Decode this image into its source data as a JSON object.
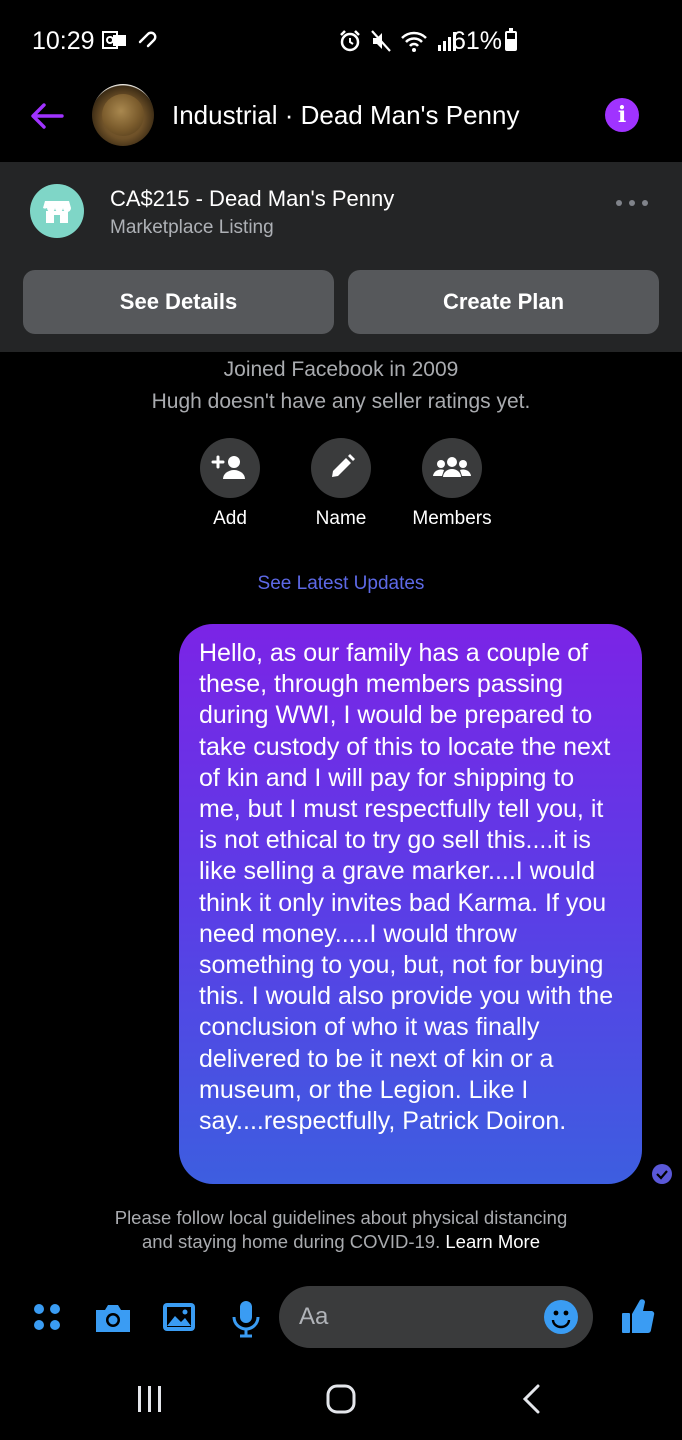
{
  "status_bar": {
    "time": "10:29",
    "battery_percent": "61%",
    "battery_level": 0.61
  },
  "header": {
    "title": "Industrial · Dead Man's Penny",
    "back_icon": "arrow-left-icon",
    "info_icon": "info-icon",
    "info_glyph": "i",
    "accent_color": "#a033ff"
  },
  "listing": {
    "title": "CA$215 - Dead Man's Penny",
    "subtitle": "Marketplace Listing",
    "see_details_label": "See Details",
    "create_plan_label": "Create Plan"
  },
  "profile": {
    "joined": "Joined Facebook in 2009",
    "ratings": "Hugh doesn't have any seller ratings yet.",
    "actions": [
      {
        "label": "Add",
        "icon": "add-person-icon"
      },
      {
        "label": "Name",
        "icon": "pencil-icon"
      },
      {
        "label": "Members",
        "icon": "group-icon"
      }
    ],
    "see_latest_updates": "See Latest Updates"
  },
  "messages": [
    {
      "sender": "me",
      "text": "Hello, as our family has a couple of these, through members passing during WWI, I would be prepared to take custody of this to locate the next of kin and I will pay for shipping to me, but I must respectfully tell you, it is not ethical to try go sell this....it is like selling a grave marker....I would think it only invites bad Karma. If you need money.....I would throw something to you, but, not for buying this. I would also provide you with the conclusion of who it was finally delivered to be it next of kin or a museum, or the Legion. Like I say....respectfully, Patrick Doiron."
    }
  ],
  "notice": {
    "line1": "Please follow local guidelines about physical distancing",
    "line2": "and staying home during COVID-19.",
    "learn_more": "Learn More"
  },
  "composer": {
    "placeholder": "Aa",
    "icons": [
      "apps-icon",
      "camera-icon",
      "gallery-icon",
      "microphone-icon",
      "emoji-icon",
      "thumbs-up-icon"
    ],
    "icon_color": "#3a9cf3"
  },
  "nav": {
    "icons": [
      "recent-apps-icon",
      "home-icon",
      "back-icon"
    ]
  }
}
